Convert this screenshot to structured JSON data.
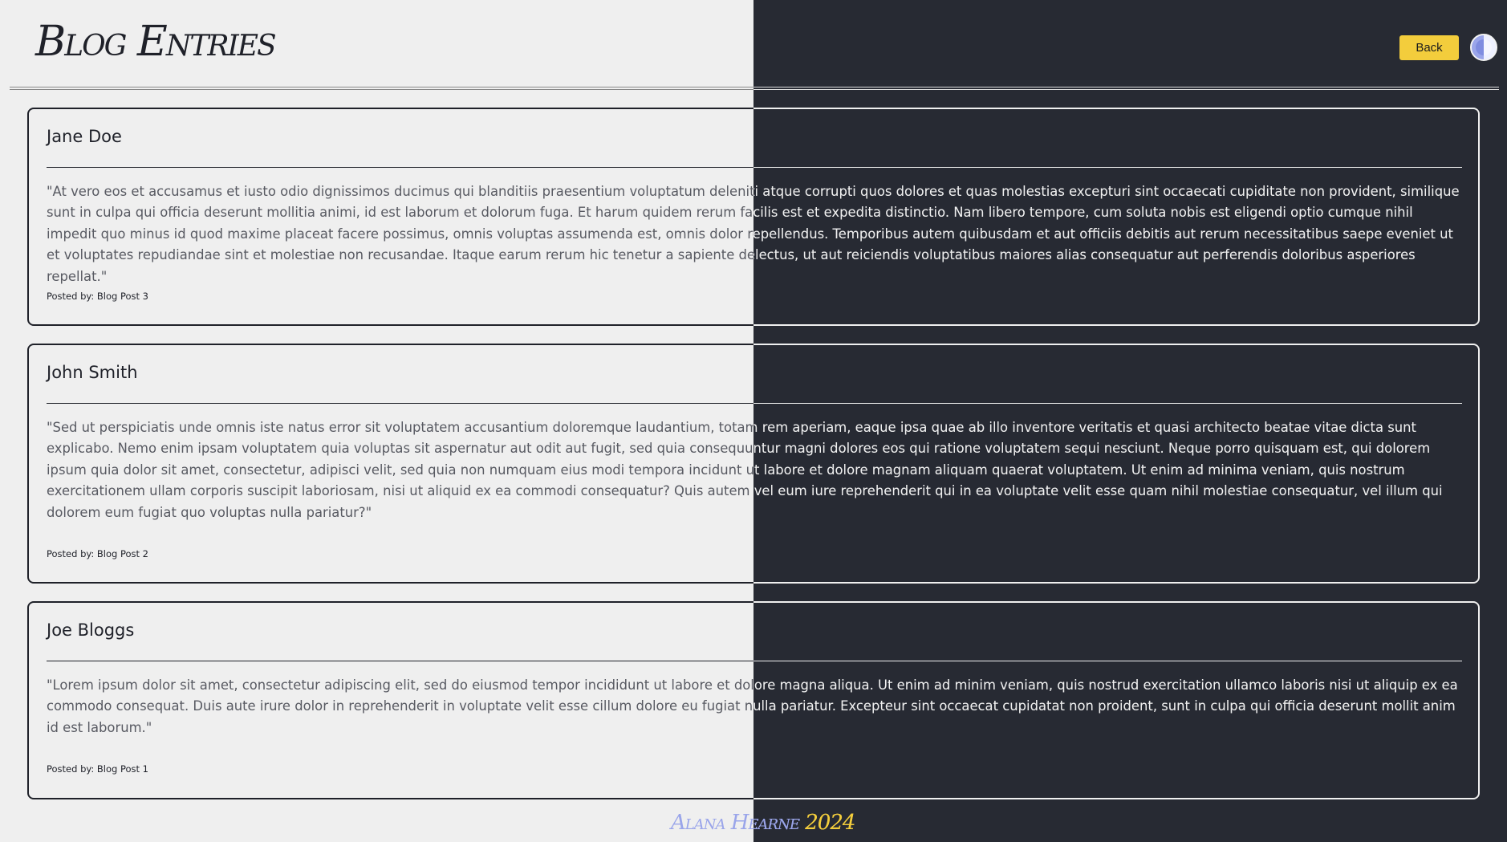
{
  "header": {
    "title": "Blog Entries",
    "back_label": "Back"
  },
  "posts": [
    {
      "author": "Jane Doe",
      "body": "\"At vero eos et accusamus et iusto odio dignissimos ducimus qui blanditiis praesentium voluptatum deleniti atque corrupti quos dolores et quas molestias excepturi sint occaecati cupiditate non provident, similique sunt in culpa qui officia deserunt mollitia animi, id est laborum et dolorum fuga. Et harum quidem rerum facilis est et expedita distinctio. Nam libero tempore, cum soluta nobis est eligendi optio cumque nihil impedit quo minus id quod maxime placeat facere possimus, omnis voluptas assumenda est, omnis dolor repellendus. Temporibus autem quibusdam et aut officiis debitis aut rerum necessitatibus saepe eveniet ut et voluptates repudiandae sint et molestiae non recusandae. Itaque earum rerum hic tenetur a sapiente delectus, ut aut reiciendis voluptatibus maiores alias consequatur aut perferendis doloribus asperiores repellat.\"",
      "meta": "Posted by: Blog Post 3"
    },
    {
      "author": "John Smith",
      "body": "\"Sed ut perspiciatis unde omnis iste natus error sit voluptatem accusantium doloremque laudantium, totam rem aperiam, eaque ipsa quae ab illo inventore veritatis et quasi architecto beatae vitae dicta sunt explicabo. Nemo enim ipsam voluptatem quia voluptas sit aspernatur aut odit aut fugit, sed quia consequuntur magni dolores eos qui ratione voluptatem sequi nesciunt. Neque porro quisquam est, qui dolorem ipsum quia dolor sit amet, consectetur, adipisci velit, sed quia non numquam eius modi tempora incidunt ut labore et dolore magnam aliquam quaerat voluptatem. Ut enim ad minima veniam, quis nostrum exercitationem ullam corporis suscipit laboriosam, nisi ut aliquid ex ea commodi consequatur? Quis autem vel eum iure reprehenderit qui in ea voluptate velit esse quam nihil molestiae consequatur, vel illum qui dolorem eum fugiat quo voluptas nulla pariatur?\"",
      "meta": "Posted by: Blog Post 2"
    },
    {
      "author": "Joe Bloggs",
      "body": "\"Lorem ipsum dolor sit amet, consectetur adipiscing elit, sed do eiusmod tempor incididunt ut labore et dolore magna aliqua. Ut enim ad minim veniam, quis nostrud exercitation ullamco laboris nisi ut aliquip ex ea commodo consequat. Duis aute irure dolor in reprehenderit in voluptate velit esse cillum dolore eu fugiat nulla pariatur. Excepteur sint occaecat cupidatat non proident, sunt in culpa qui officia deserunt mollit anim id est laborum.\"",
      "meta": "Posted by: Blog Post 1"
    }
  ],
  "footer": {
    "name": "Alana Hearne",
    "year": "2024"
  },
  "colors": {
    "light_bg": "#efefef",
    "dark_bg": "#272a33",
    "accent_yellow": "#f3cd3c",
    "accent_periwinkle": "#9aa5ea"
  },
  "icons": {
    "theme_toggle": "half-circle-contrast-icon"
  }
}
